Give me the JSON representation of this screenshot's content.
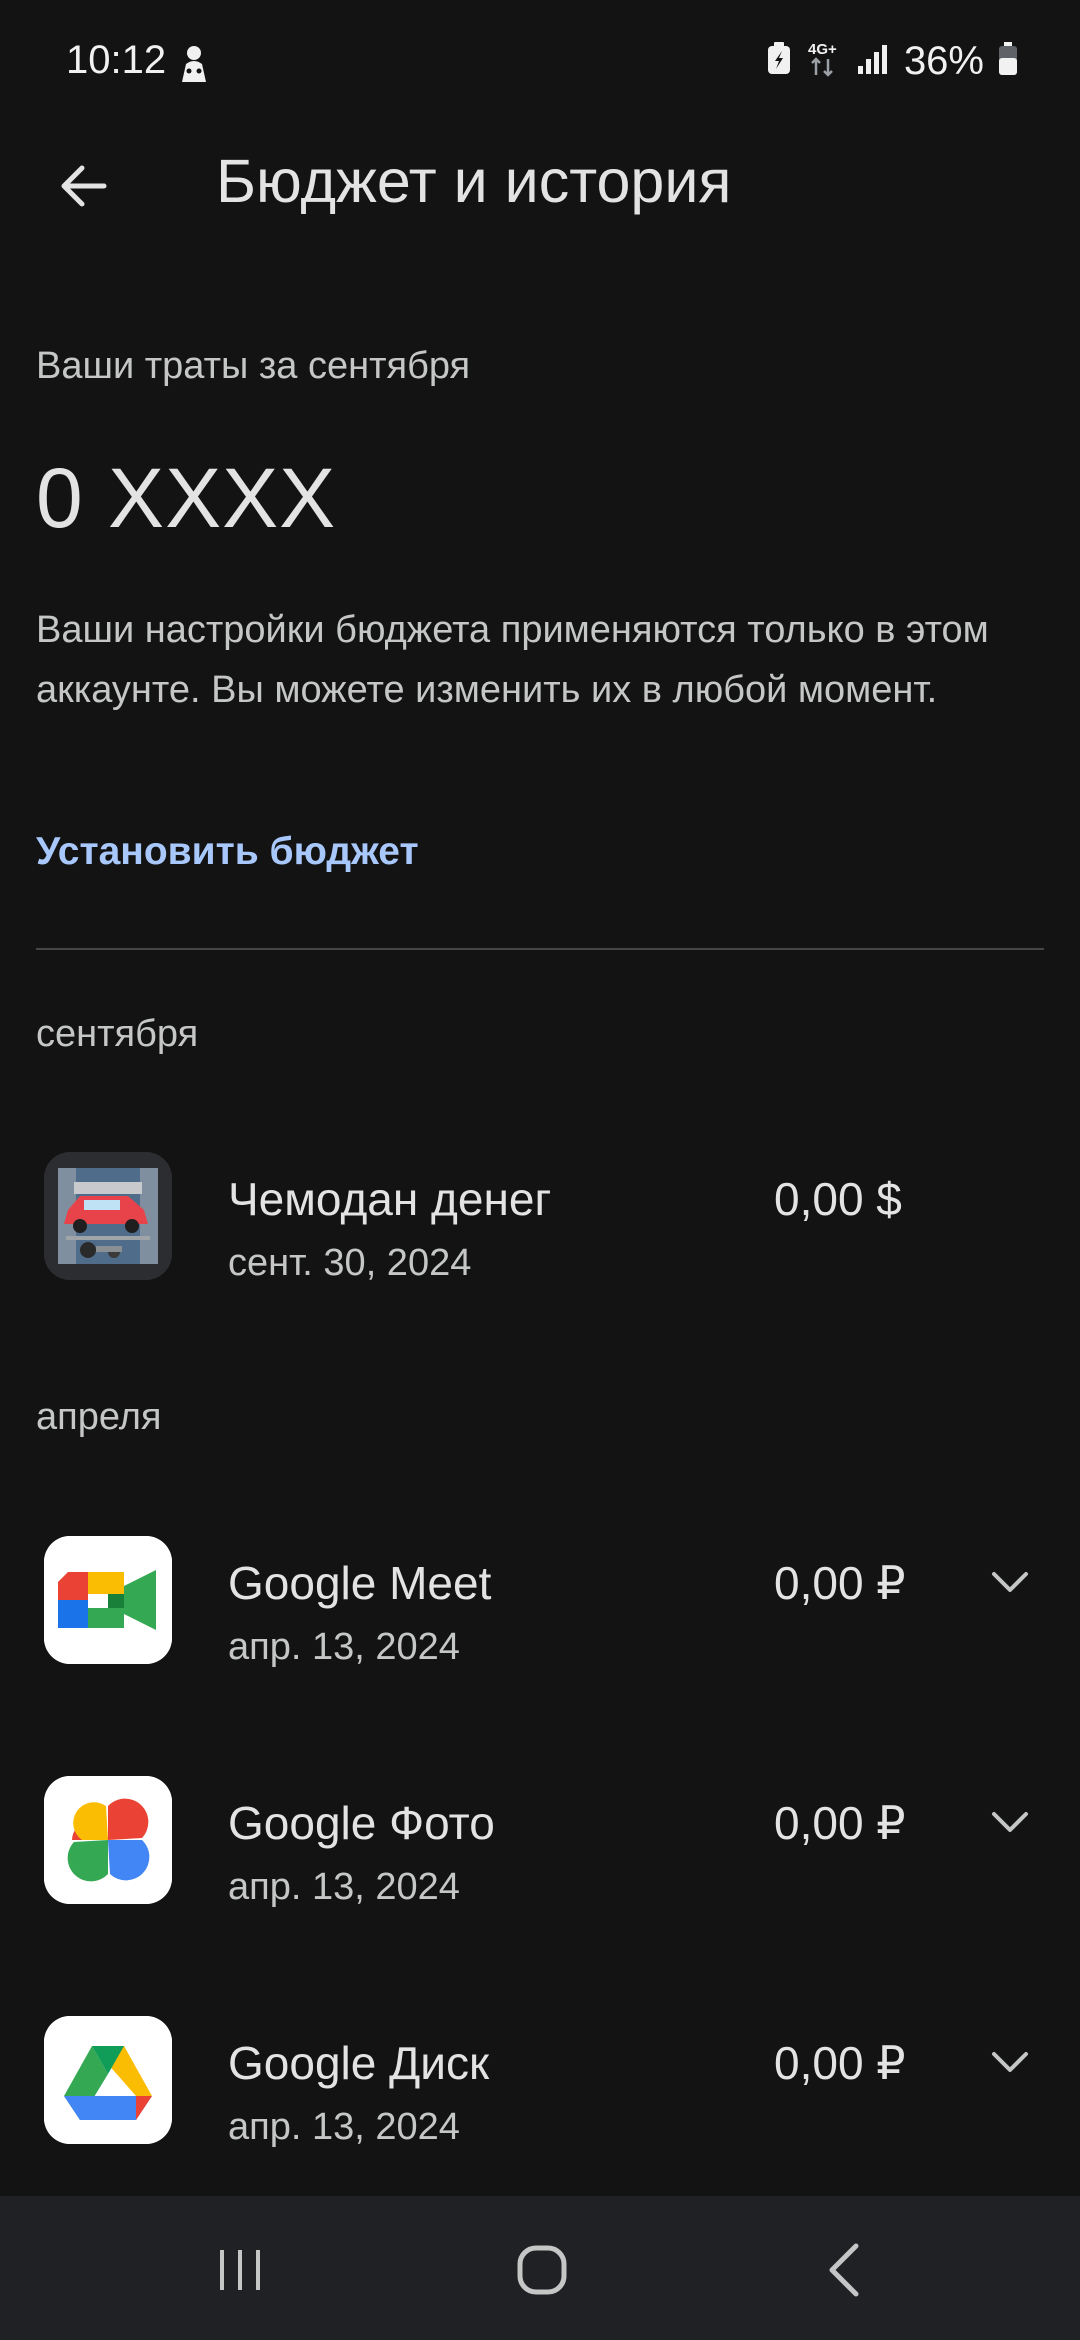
{
  "status_bar": {
    "time": "10:12",
    "network": "4G+",
    "battery_percent": "36%",
    "left_icon": "notification-figure-icon",
    "right_icons": [
      "battery-saver-icon",
      "network-4g-icon",
      "signal-icon",
      "battery-icon"
    ]
  },
  "header": {
    "title": "Бюджет и история",
    "back_icon": "arrow-back-icon"
  },
  "summary": {
    "label": "Ваши траты за сентября",
    "amount": "0 XXXX",
    "note": "Ваши настройки бюджета применяются только в этом аккаунте. Вы можете изменить их в любой момент.",
    "set_budget": "Установить бюджет"
  },
  "sections": [
    {
      "label": "сентября",
      "items": [
        {
          "name": "Чемодан денег",
          "date": "сент. 30, 2024",
          "amount": "0,00 $",
          "icon": "game-car-icon",
          "expandable": false
        }
      ]
    },
    {
      "label": "апреля",
      "items": [
        {
          "name": "Google Meet",
          "date": "апр. 13, 2024",
          "amount": "0,00 ₽",
          "icon": "google-meet-icon",
          "expandable": true
        },
        {
          "name": "Google Фото",
          "date": "апр. 13, 2024",
          "amount": "0,00 ₽",
          "icon": "google-photos-icon",
          "expandable": true
        },
        {
          "name": "Google Диск",
          "date": "апр. 13, 2024",
          "amount": "0,00 ₽",
          "icon": "google-drive-icon",
          "expandable": true
        }
      ]
    }
  ],
  "nav_bar": {
    "icons": [
      "recents-icon",
      "home-icon",
      "back-nav-icon"
    ]
  },
  "colors": {
    "background": "#131314",
    "accent_link": "#a8c7fa",
    "divider": "#444746",
    "nav_background": "#202124"
  }
}
